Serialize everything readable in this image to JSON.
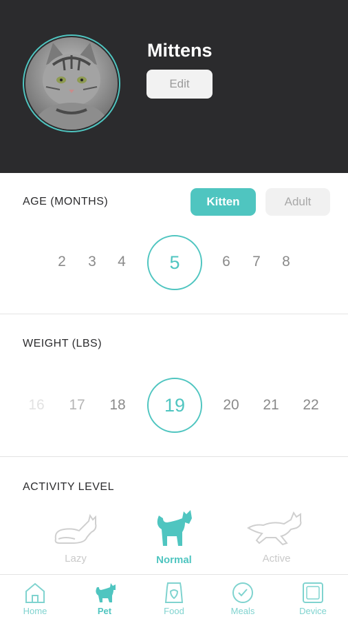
{
  "pet": {
    "name": "Mittens",
    "edit_label": "Edit"
  },
  "age": {
    "title": "AGE (MONTHS)",
    "kitten_label": "Kitten",
    "adult_label": "Adult",
    "values": [
      "2",
      "3",
      "4",
      "5",
      "6",
      "7",
      "8"
    ],
    "selected": "5"
  },
  "weight": {
    "title": "WEIGHT (LBS)",
    "values": [
      "16",
      "17",
      "18",
      "19",
      "20",
      "21",
      "22"
    ],
    "selected": "19"
  },
  "activity": {
    "title": "ACTIVITY LEVEL",
    "options": [
      {
        "label": "Lazy",
        "icon": "lazy-cat-icon"
      },
      {
        "label": "Normal",
        "icon": "normal-cat-icon"
      },
      {
        "label": "Active",
        "icon": "active-cat-icon"
      }
    ],
    "selected": "Normal"
  },
  "tabs": [
    {
      "label": "Home",
      "icon": "home-icon"
    },
    {
      "label": "Pet",
      "icon": "pet-icon"
    },
    {
      "label": "Food",
      "icon": "food-icon"
    },
    {
      "label": "Meals",
      "icon": "meals-icon"
    },
    {
      "label": "Device",
      "icon": "device-icon"
    }
  ],
  "selected_tab": "Pet",
  "colors": {
    "accent": "#4fc5c0",
    "header_bg": "#2b2b2d"
  }
}
